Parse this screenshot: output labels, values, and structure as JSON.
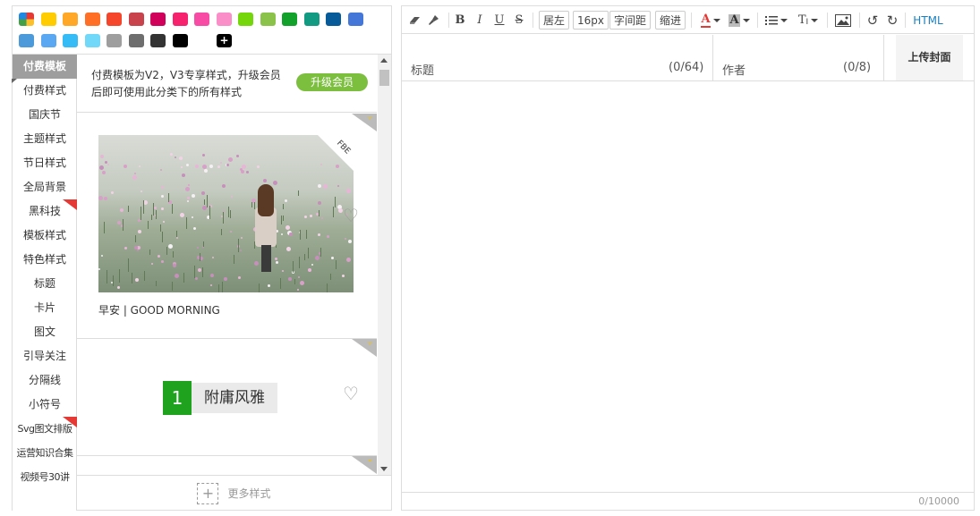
{
  "palette": {
    "swatches": [
      "#ffcc00",
      "#ffa726",
      "#ff6f26",
      "#f5452a",
      "#c8434b",
      "#d1005a",
      "#f7226e",
      "#f74ba5",
      "#f98ec8",
      "#74d60b",
      "#8bc34a",
      "#12a12b",
      "#129a82",
      "#085b99",
      "#4577d9",
      "#4d9adb",
      "#5aa8f2",
      "#35bbf5",
      "#72d8f9",
      "#9e9e9e",
      "#6e6e6e",
      "#333333",
      "#000000"
    ],
    "add_symbol": "+"
  },
  "categories": [
    {
      "label": "付费模板",
      "active": true
    },
    {
      "label": "付费样式"
    },
    {
      "label": "国庆节"
    },
    {
      "label": "主题样式"
    },
    {
      "label": "节日样式"
    },
    {
      "label": "全局背景"
    },
    {
      "label": "黑科技",
      "flag": true
    },
    {
      "label": "模板样式"
    },
    {
      "label": "特色样式"
    },
    {
      "label": "标题"
    },
    {
      "label": "卡片"
    },
    {
      "label": "图文"
    },
    {
      "label": "引导关注"
    },
    {
      "label": "分隔线"
    },
    {
      "label": "小符号"
    },
    {
      "label": "Svg图文排版",
      "flag": true
    },
    {
      "label": "运营知识合集"
    },
    {
      "label": "视频号30讲"
    }
  ],
  "notice": {
    "line1": "付费模板为V2，V3专享样式，升级会员",
    "line2": "后即可使用此分类下的所有样式",
    "upgrade_label": "升级会员"
  },
  "style_cards": [
    {
      "photo_tag": "FBE",
      "caption": "早安 | GOOD MORNING"
    },
    {
      "number": "1",
      "title": "附庸风雅"
    }
  ],
  "more_styles_label": "更多样式",
  "toolbar": {
    "bold": "B",
    "italic": "I",
    "underline": "U",
    "strike": "S",
    "align": "居左",
    "font_size": "16px",
    "letter_spacing": "字间距",
    "indent": "缩进",
    "font_color": "A",
    "bg_color": "A",
    "format": "T",
    "html": "HTML",
    "accent_color": "#1a7fc1"
  },
  "meta": {
    "title_label": "标题",
    "title_count": "(0/64)",
    "author_label": "作者",
    "author_count": "(0/8)",
    "cover_label": "上传封面"
  },
  "editor": {
    "word_count": "0/10000"
  }
}
